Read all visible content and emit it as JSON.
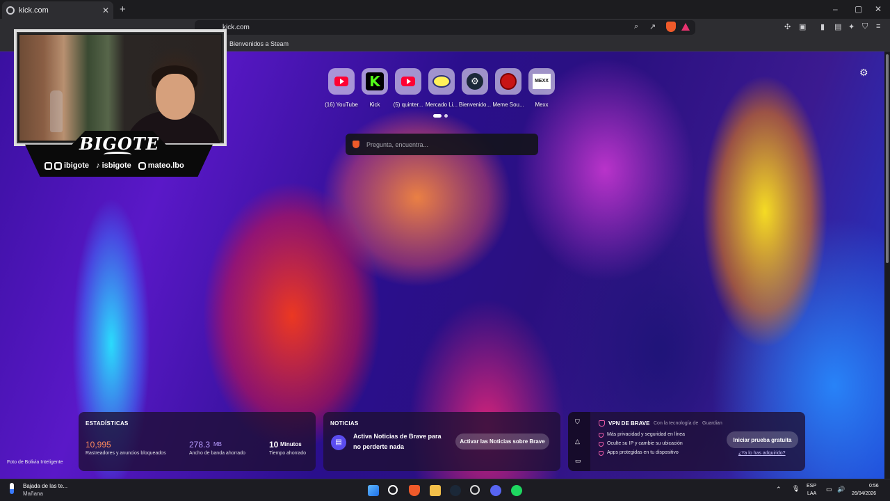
{
  "browser": {
    "tab": {
      "title": "kick.com",
      "close": "✕"
    },
    "new_tab": "+",
    "window_controls": {
      "minimize": "–",
      "maximize": "▢",
      "close": "✕"
    },
    "address": "kick.com",
    "bookmarks": [
      {
        "label": "Bienvenidos a Steam"
      }
    ]
  },
  "new_tab_page": {
    "top_sites": [
      {
        "label": "(16) YouTube",
        "icon": "youtube-icon"
      },
      {
        "label": "Kick",
        "icon": "kick-icon"
      },
      {
        "label": "(5) quinter...",
        "icon": "youtube-icon"
      },
      {
        "label": "Mercado Li...",
        "icon": "mercadolibre-icon"
      },
      {
        "label": "Bienvenido...",
        "icon": "steam-icon"
      },
      {
        "label": "Meme Sou...",
        "icon": "meme-icon"
      },
      {
        "label": "Mexx",
        "icon": "mexx-icon"
      }
    ],
    "kick_glyph": "K",
    "mexx_glyph": "MEXX",
    "search_placeholder": "Pregunta, encuentra...",
    "photo_credit": "Foto de Bolivia Inteligente"
  },
  "stats_card": {
    "title": "ESTADÍSTICAS",
    "trackers_value": "10,995",
    "trackers_label": "Rastreadores y anuncios bloqueados",
    "bandwidth_value": "278.3",
    "bandwidth_unit": "MB",
    "bandwidth_label": "Ancho de banda ahorrado",
    "time_value": "10",
    "time_unit": "Minutos",
    "time_label": "Tiempo ahorrado",
    "colors": {
      "trackers": "#ff8a5c",
      "bandwidth": "#b89cff"
    }
  },
  "news_card": {
    "title": "NOTICIAS",
    "message_line1": "Activa Noticias de Brave para",
    "message_line2": "no perderte nada",
    "button": "Activar las Noticias sobre Brave"
  },
  "vpn_card": {
    "title": "VPN DE BRAVE",
    "powered_by": "Con la tecnología de",
    "partner": "Guardian",
    "features": [
      "Más privacidad y seguridad en línea",
      "Oculte su IP y cambie su ubicación",
      "Apps protegidas en tu dispositivo"
    ],
    "cta": "Iniciar prueba gratuita",
    "already": "¿Ya lo has adquirido?"
  },
  "webcam_overlay": {
    "name": "BIGOTE",
    "socials": [
      {
        "icons": "twitch-icon kick-icon",
        "handle": "ibigote"
      },
      {
        "icons": "tiktok-icon",
        "handle": "isbigote"
      },
      {
        "icons": "instagram-icon",
        "handle": "mateo.lbo"
      }
    ]
  },
  "taskbar": {
    "weather_title": "Bajada de las te...",
    "weather_sub": "Mañana",
    "language": "ESP",
    "layout": "LAA",
    "time": "0:56",
    "date": "26/04/2026"
  }
}
